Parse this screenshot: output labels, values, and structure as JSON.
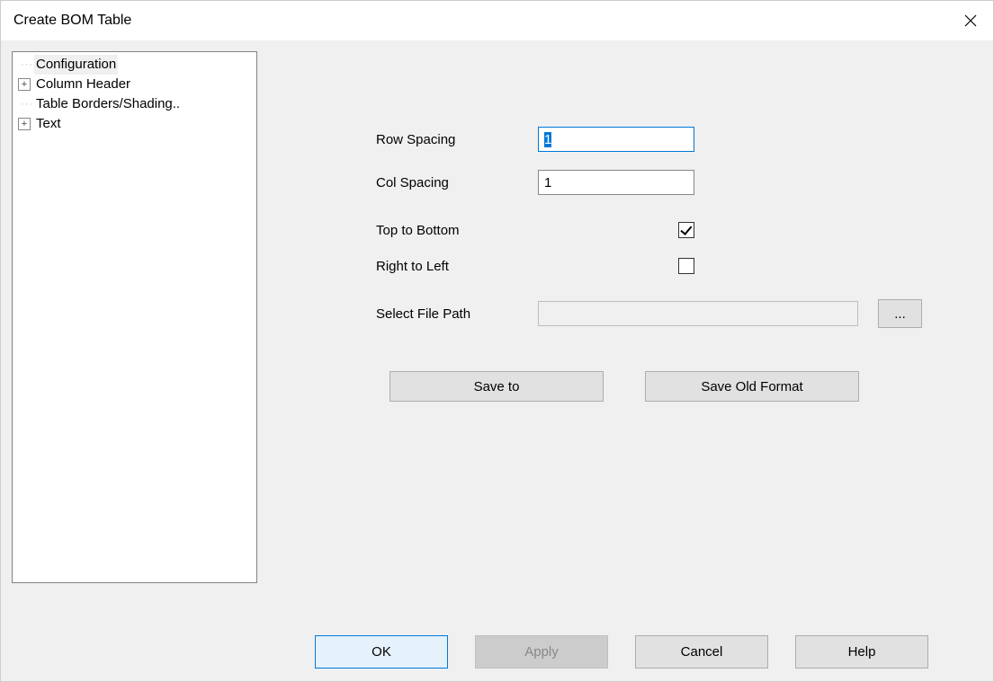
{
  "window": {
    "title": "Create BOM Table"
  },
  "tree": {
    "items": [
      {
        "label": "Configuration",
        "expander": "none",
        "selected": true
      },
      {
        "label": "Column Header",
        "expander": "plus",
        "selected": false
      },
      {
        "label": "Table Borders/Shading..",
        "expander": "none",
        "selected": false
      },
      {
        "label": "Text",
        "expander": "plus",
        "selected": false
      }
    ]
  },
  "form": {
    "row_spacing_label": "Row Spacing",
    "row_spacing_value": "1",
    "col_spacing_label": "Col Spacing",
    "col_spacing_value": "1",
    "top_to_bottom_label": "Top to Bottom",
    "top_to_bottom_checked": true,
    "right_to_left_label": "Right to Left",
    "right_to_left_checked": false,
    "select_path_label": "Select File Path",
    "select_path_value": "",
    "browse_label": "...",
    "save_to_label": "Save to",
    "save_old_label": "Save Old Format"
  },
  "buttons": {
    "ok": "OK",
    "apply": "Apply",
    "cancel": "Cancel",
    "help": "Help"
  }
}
